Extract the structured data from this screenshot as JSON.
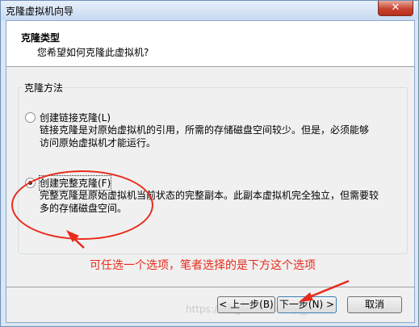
{
  "window": {
    "title": "克隆虚拟机向导",
    "close_glyph": "✕"
  },
  "header": {
    "title": "克隆类型",
    "subtitle": "您希望如何克隆此虚拟机?"
  },
  "group": {
    "label": "克隆方法"
  },
  "options": [
    {
      "label": "创建链接克隆(L)",
      "desc_line1": "链接克隆是对原始虚拟机的引用，所需的存储磁盘空间较少。但是，必须能够",
      "desc_line2": "访问原始虚拟机才能运行。",
      "selected": false
    },
    {
      "label": "创建完整克隆(F)",
      "desc_line1": "完整克隆是原始虚拟机当前状态的完整副本。此副本虚拟机完全独立，但需要较",
      "desc_line2": "多的存储磁盘空间。",
      "selected": true
    }
  ],
  "annotation": {
    "text": "可任选一个选项，笔者选择的是下方这个选项",
    "color": "#e82a1c"
  },
  "watermark": "https://blog.csdn.net/qq_39...",
  "buttons": {
    "back": "< 上一步(B)",
    "next": "下一步(N) >",
    "cancel": "取消"
  }
}
